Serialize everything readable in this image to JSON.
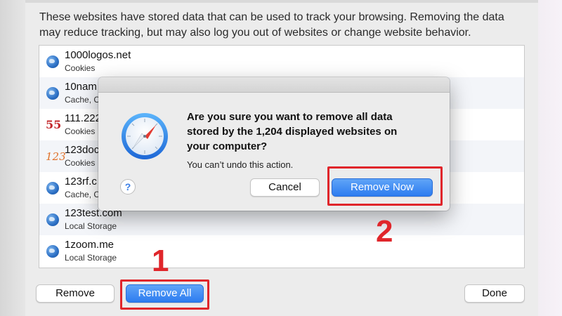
{
  "description": {
    "line1": "These websites have stored data that can be used to track your browsing. Removing the data",
    "line2": "may reduce tracking, but may also log you out of websites or change website behavior."
  },
  "sites": [
    {
      "name": "1000logos.net",
      "type": "Cookies",
      "icon": "globe-icon"
    },
    {
      "name": "10nam",
      "type": "Cache, C",
      "icon": "globe-icon"
    },
    {
      "name": "111.222",
      "type": "Cookies",
      "icon": "55-favicon"
    },
    {
      "name": "123doc",
      "type": "Cookies",
      "icon": "123-favicon"
    },
    {
      "name": "123rf.c",
      "type": "Cache, C",
      "icon": "globe-icon"
    },
    {
      "name": "123test.com",
      "type": "Local Storage",
      "icon": "globe-icon"
    },
    {
      "name": "1zoom.me",
      "type": "Local Storage",
      "icon": "globe-icon"
    }
  ],
  "favicons": {
    "fav55": "55",
    "fav123": "123"
  },
  "buttons": {
    "remove": "Remove",
    "remove_all": "Remove All",
    "done": "Done"
  },
  "dialog": {
    "title_line1": "Are you sure you want to remove all data",
    "title_line2": "stored by the 1,204 displayed websites on",
    "title_line3": "your computer?",
    "subtitle": "You can’t undo this action.",
    "help": "?",
    "cancel": "Cancel",
    "confirm": "Remove Now"
  },
  "annotations": {
    "step1": "1",
    "step2": "2"
  },
  "colors": {
    "accent": "#2d7cf0",
    "annotation": "#e0262b"
  }
}
